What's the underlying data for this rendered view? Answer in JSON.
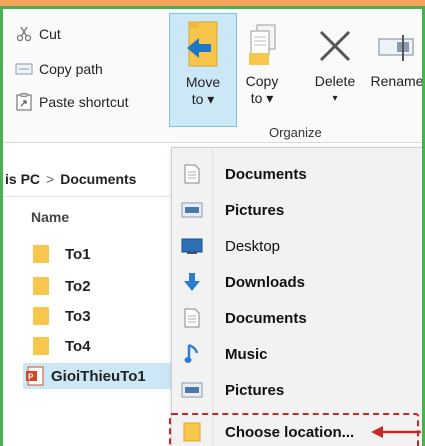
{
  "clipboard": {
    "cut_label": "Cut",
    "copy_path_label": "Copy path",
    "paste_shortcut_label": "Paste shortcut"
  },
  "organize": {
    "move_to_line1": "Move",
    "move_to_line2": "to ▾",
    "copy_to_line1": "Copy",
    "copy_to_line2": "to ▾",
    "delete_label": "Delete",
    "delete_arrow": "▾",
    "rename_label": "Rename",
    "group_label": "Organize"
  },
  "breadcrumb": {
    "part1": "is PC",
    "separator": ">",
    "part2": "Documents"
  },
  "file_list": {
    "column_name": "Name",
    "items": [
      {
        "name": "To1",
        "type": "folder"
      },
      {
        "name": "To2",
        "type": "folder"
      },
      {
        "name": "To3",
        "type": "folder"
      },
      {
        "name": "To4",
        "type": "folder"
      },
      {
        "name": "GioiThieuTo1",
        "type": "powerpoint",
        "selected": true
      }
    ]
  },
  "move_to_menu": {
    "items": [
      {
        "label": "Documents",
        "icon": "document-icon"
      },
      {
        "label": "Pictures",
        "icon": "pictures-icon"
      },
      {
        "label": "Desktop",
        "icon": "desktop-icon"
      },
      {
        "label": "Downloads",
        "icon": "download-arrow-icon"
      },
      {
        "label": "Documents",
        "icon": "document-icon"
      },
      {
        "label": "Music",
        "icon": "music-note-icon"
      },
      {
        "label": "Pictures",
        "icon": "pictures-icon"
      }
    ],
    "choose_location_label": "Choose location..."
  },
  "colors": {
    "frame_border": "#4caf50",
    "highlight": "#cce8f6",
    "annotation_red": "#c62828",
    "folder_yellow": "#f8c64b",
    "move_arrow_blue": "#1e78c8"
  }
}
